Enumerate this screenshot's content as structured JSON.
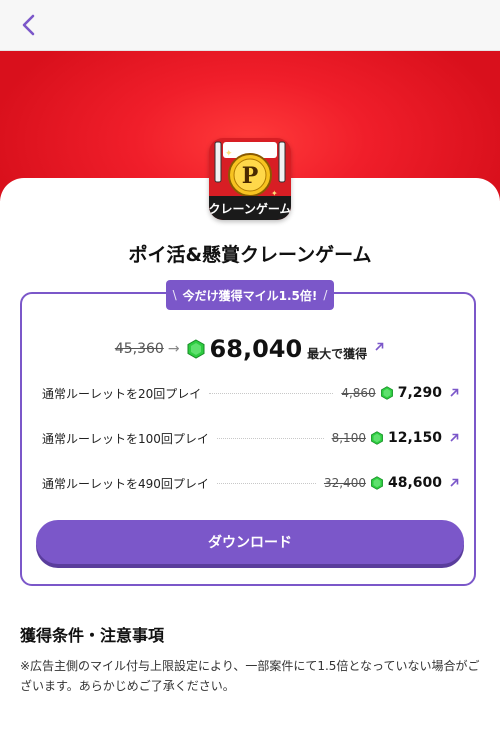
{
  "header": {
    "back_icon": "chevron-left-icon"
  },
  "app": {
    "title": "ポイ活&懸賞クレーンゲーム",
    "icon": "crane-game-app-icon",
    "icon_text": "クレーンゲーム",
    "icon_letter": "P"
  },
  "offer": {
    "ribbon_text": "今だけ獲得マイル1.5倍!",
    "ribbon_left": "\\",
    "ribbon_right": "/",
    "total_old": "45,360",
    "total_new": "68,040",
    "total_suffix": "最大で獲得",
    "arrow": "→"
  },
  "tasks": [
    {
      "label": "通常ルーレットを20回プレイ",
      "old": "4,860",
      "new": "7,290"
    },
    {
      "label": "通常ルーレットを100回プレイ",
      "old": "8,100",
      "new": "12,150"
    },
    {
      "label": "通常ルーレットを490回プレイ",
      "old": "32,400",
      "new": "48,600"
    }
  ],
  "download_label": "ダウンロード",
  "conditions": {
    "title": "獲得条件・注意事項",
    "note": "※広告主側のマイル付与上限設定により、一部案件にて1.5倍となっていない場合がございます。あらかじめご了承ください。"
  },
  "colors": {
    "accent": "#7b57c9",
    "hero_red": "#f01e2a",
    "gem": "#2ecc40"
  }
}
